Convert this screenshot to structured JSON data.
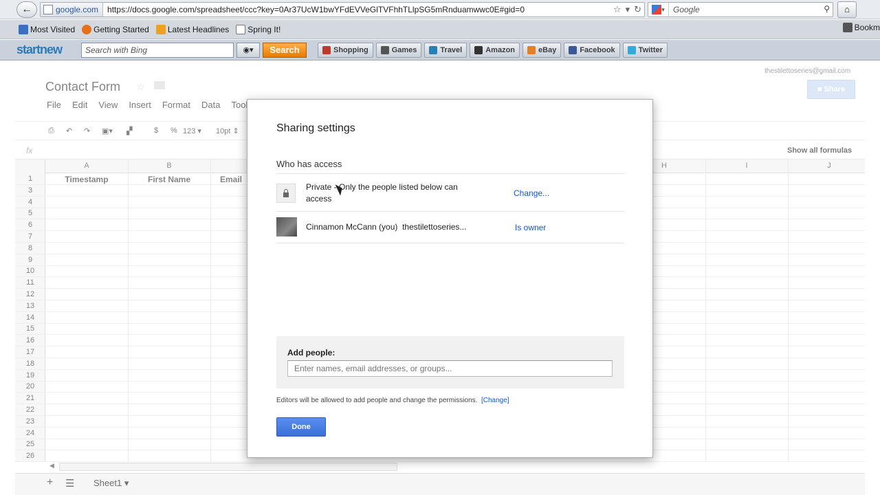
{
  "browser": {
    "site_badge": "google.com",
    "url": "https://docs.google.com/spreadsheet/ccc?key=0Ar37UcW1bwYFdEVVeGlTVFhhTLlpSG5mRnduamwwc0E#gid=0",
    "search_placeholder": "Google",
    "bookmarks": [
      {
        "label": "Most Visited",
        "color": "#3b6fc4"
      },
      {
        "label": "Getting Started",
        "color": "#e8701a"
      },
      {
        "label": "Latest Headlines",
        "color": "#f0a020"
      },
      {
        "label": "Spring It!",
        "color": "#ffffff"
      }
    ],
    "bookmarks_right": "Bookm"
  },
  "toolbar": {
    "brand": "startnew",
    "search_placeholder": "Search with Bing",
    "search_button": "Search",
    "buttons": [
      {
        "label": "Shopping",
        "color": "#c0392b"
      },
      {
        "label": "Games",
        "color": "#555555"
      },
      {
        "label": "Travel",
        "color": "#2980b9"
      },
      {
        "label": "Amazon",
        "color": "#333333"
      },
      {
        "label": "eBay",
        "color": "#e67e22"
      },
      {
        "label": "Facebook",
        "color": "#3b5998"
      },
      {
        "label": "Twitter",
        "color": "#33aadd"
      }
    ]
  },
  "sheets": {
    "title": "Contact Form",
    "account_email": "thestilettoseries@gmail.com",
    "share_label": "Share",
    "menu": [
      "File",
      "Edit",
      "View",
      "Insert",
      "Format",
      "Data",
      "Tools"
    ],
    "formatting": {
      "currency": "$",
      "percent": "%",
      "number_format": "123",
      "font_size": "10pt"
    },
    "fx_label": "fx",
    "show_formulas": "Show all formulas",
    "columns_left": [
      "A",
      "B"
    ],
    "columns_right": [
      "H",
      "I",
      "J"
    ],
    "header_row": [
      "Timestamp",
      "First Name",
      "Email"
    ],
    "rows": [
      "1",
      "3",
      "4",
      "5",
      "6",
      "7",
      "8",
      "9",
      "10",
      "11",
      "12",
      "13",
      "14",
      "15",
      "16",
      "17",
      "18",
      "19",
      "20",
      "21",
      "22",
      "23",
      "24",
      "25",
      "26"
    ],
    "sheet_tab": "Sheet1"
  },
  "dialog": {
    "title": "Sharing settings",
    "who_has_access": "Who has access",
    "access_text": "Private - Only the people listed below can access",
    "change_link": "Change...",
    "owner_name": "Cinnamon McCann (you)",
    "owner_email": "thestilettoseries...",
    "owner_role": "Is owner",
    "add_people_label": "Add people:",
    "add_people_placeholder": "Enter names, email addresses, or groups...",
    "editors_note": "Editors will be allowed to add people and change the permissions.",
    "editors_change": "[Change]",
    "done_label": "Done"
  }
}
